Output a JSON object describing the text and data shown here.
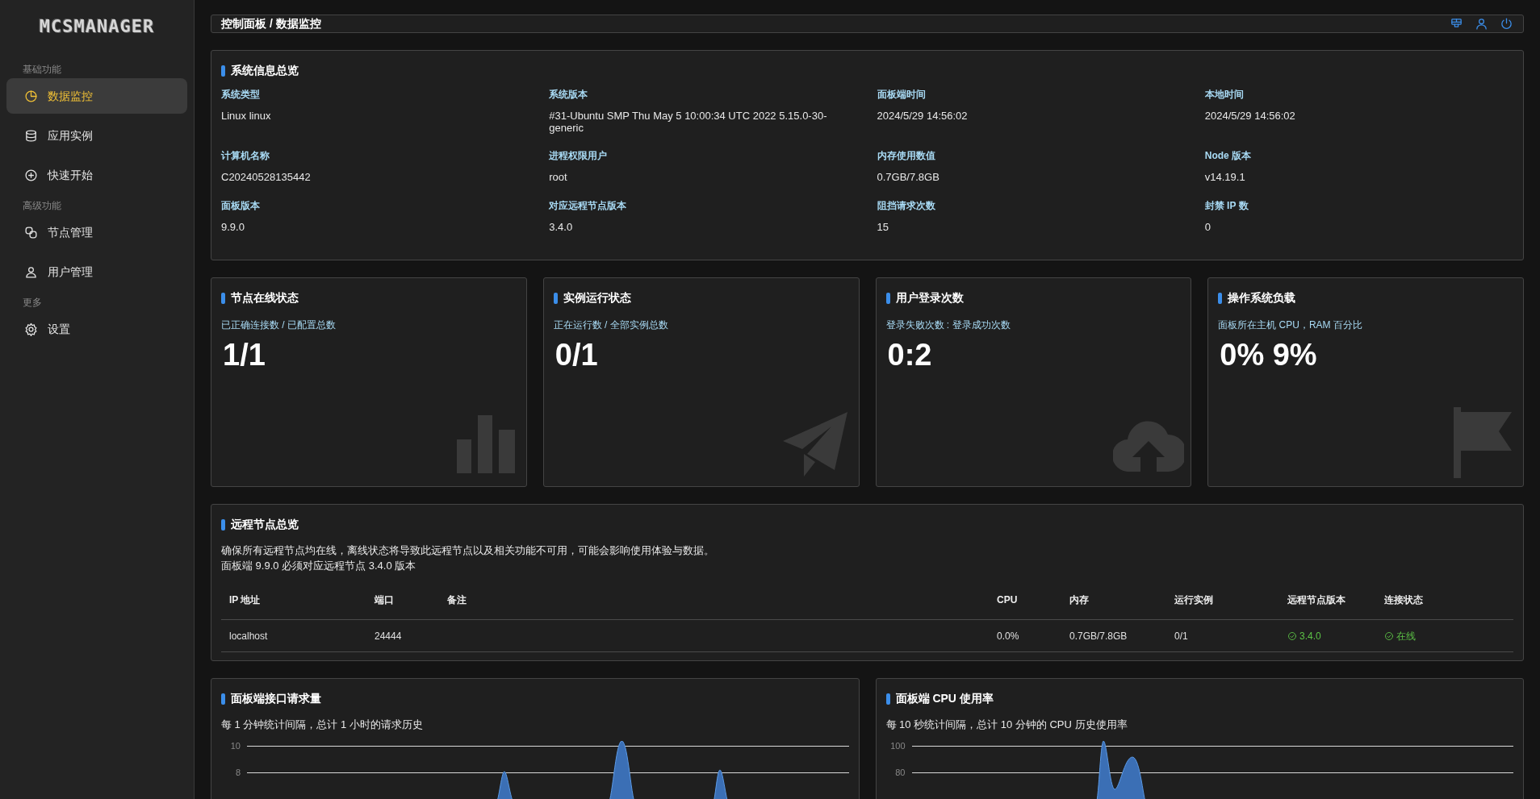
{
  "sidebar": {
    "logo": "MCSMANAGER",
    "groups": [
      {
        "heading": "基础功能",
        "items": [
          {
            "label": "数据监控",
            "selected": true
          },
          {
            "label": "应用实例",
            "selected": false
          },
          {
            "label": "快速开始",
            "selected": false
          }
        ]
      },
      {
        "heading": "高级功能",
        "items": [
          {
            "label": "节点管理",
            "selected": false
          },
          {
            "label": "用户管理",
            "selected": false
          }
        ]
      },
      {
        "heading": "更多",
        "items": [
          {
            "label": "设置",
            "selected": false
          }
        ]
      }
    ]
  },
  "header": {
    "breadcrumb": "控制面板 / 数据监控"
  },
  "system_info": {
    "title": "系统信息总览",
    "fields": [
      {
        "label": "系统类型",
        "value": "Linux linux"
      },
      {
        "label": "系统版本",
        "value": "#31-Ubuntu SMP Thu May 5 10:00:34 UTC 2022 5.15.0-30-generic"
      },
      {
        "label": "面板端时间",
        "value": "2024/5/29 14:56:02"
      },
      {
        "label": "本地时间",
        "value": "2024/5/29 14:56:02"
      },
      {
        "label": "计算机名称",
        "value": "C20240528135442"
      },
      {
        "label": "进程权限用户",
        "value": "root"
      },
      {
        "label": "内存使用数值",
        "value": "0.7GB/7.8GB"
      },
      {
        "label": "Node 版本",
        "value": "v14.19.1"
      },
      {
        "label": "面板版本",
        "value": "9.9.0"
      },
      {
        "label": "对应远程节点版本",
        "value": "3.4.0"
      },
      {
        "label": "阻挡请求次数",
        "value": "15"
      },
      {
        "label": "封禁 IP 数",
        "value": "0"
      }
    ]
  },
  "stat_cards": [
    {
      "title": "节点在线状态",
      "subtitle": "已正确连接数 / 已配置总数",
      "value": "1/1"
    },
    {
      "title": "实例运行状态",
      "subtitle": "正在运行数 / 全部实例总数",
      "value": "0/1"
    },
    {
      "title": "用户登录次数",
      "subtitle": "登录失败次数 : 登录成功次数",
      "value": "0:2"
    },
    {
      "title": "操作系统负载",
      "subtitle": "面板所在主机 CPU，RAM 百分比",
      "value": "0% 9%"
    }
  ],
  "remote_nodes": {
    "title": "远程节点总览",
    "description": [
      "确保所有远程节点均在线，离线状态将导致此远程节点以及相关功能不可用，可能会影响使用体验与数据。",
      "面板端 9.9.0 必须对应远程节点 3.4.0 版本"
    ],
    "columns": [
      "IP 地址",
      "端口",
      "备注",
      "CPU",
      "内存",
      "运行实例",
      "远程节点版本",
      "连接状态"
    ],
    "rows": [
      {
        "ip": "localhost",
        "port": "24444",
        "cpu": "0.0%",
        "memory": "0.7GB/7.8GB",
        "instances": "0/1",
        "version": "3.4.0",
        "status": "在线"
      }
    ]
  },
  "charts": [
    {
      "title": "面板端接口请求量",
      "subtitle": "每 1 分钟统计间隔，总计 1 小时的请求历史",
      "ticks": [
        "10",
        "8"
      ]
    },
    {
      "title": "面板端 CPU 使用率",
      "subtitle": "每 10 秒统计间隔，总计 10 分钟的 CPU 历史使用率",
      "ticks": [
        "100",
        "80"
      ]
    }
  ]
}
